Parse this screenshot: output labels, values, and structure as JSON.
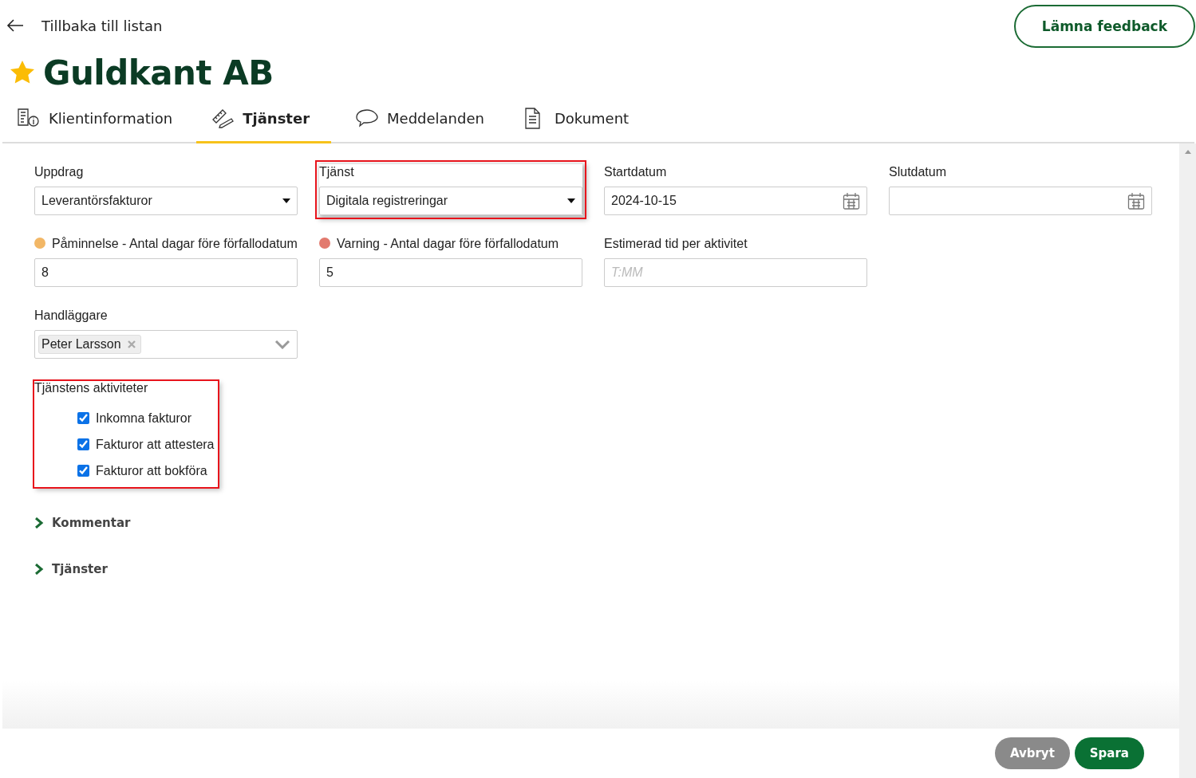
{
  "back_link": {
    "label": "Tillbaka till listan"
  },
  "feedback_button": {
    "label": "Lämna feedback"
  },
  "client": {
    "name": "Guldkant AB",
    "favorite": true
  },
  "tabs": [
    {
      "label": "Klientinformation",
      "selected": false
    },
    {
      "label": "Tjänster",
      "selected": true
    },
    {
      "label": "Meddelanden",
      "selected": false
    },
    {
      "label": "Dokument",
      "selected": false
    }
  ],
  "form_rows": [
    [
      {
        "kind": "select",
        "label": "Uppdrag",
        "value": "Leverantörsfakturor",
        "highlighted": false
      },
      {
        "kind": "select",
        "label": "Tjänst",
        "value": "Digitala registreringar",
        "highlighted": true
      },
      {
        "kind": "date",
        "label": "Startdatum",
        "value": "2024-10-15",
        "highlighted": false
      },
      {
        "kind": "date",
        "label": "Slutdatum",
        "highlighted": false
      }
    ],
    [
      {
        "kind": "text",
        "label": "Påminnelse - Antal dagar före förfallodatum",
        "color": "#f2b766",
        "value": "8",
        "highlighted": false
      },
      {
        "kind": "text",
        "label": "Varning - Antal dagar före förfallodatum",
        "color": "#e27a6e",
        "value": "5",
        "highlighted": false
      },
      {
        "kind": "text",
        "label": "Estimerad tid per aktivitet",
        "placeholder": "T:MM",
        "highlighted": false
      }
    ],
    [
      {
        "kind": "tags",
        "label": "Handläggare",
        "tags": [
          "Peter Larsson"
        ],
        "highlighted": false
      }
    ]
  ],
  "activities": {
    "title": "Tjänstens aktiviteter",
    "highlighted": true,
    "items": [
      {
        "label": "Inkomna fakturor",
        "checked": true
      },
      {
        "label": "Fakturor att attestera",
        "checked": true
      },
      {
        "label": "Fakturor att bokföra",
        "checked": true
      }
    ]
  },
  "sections": [
    {
      "label": "Kommentar",
      "expanded": false
    },
    {
      "label": "Tjänster",
      "expanded": false
    }
  ],
  "footer_buttons": [
    {
      "label": "Avbryt",
      "kind": "secondary"
    },
    {
      "label": "Spara",
      "kind": "primary"
    }
  ]
}
